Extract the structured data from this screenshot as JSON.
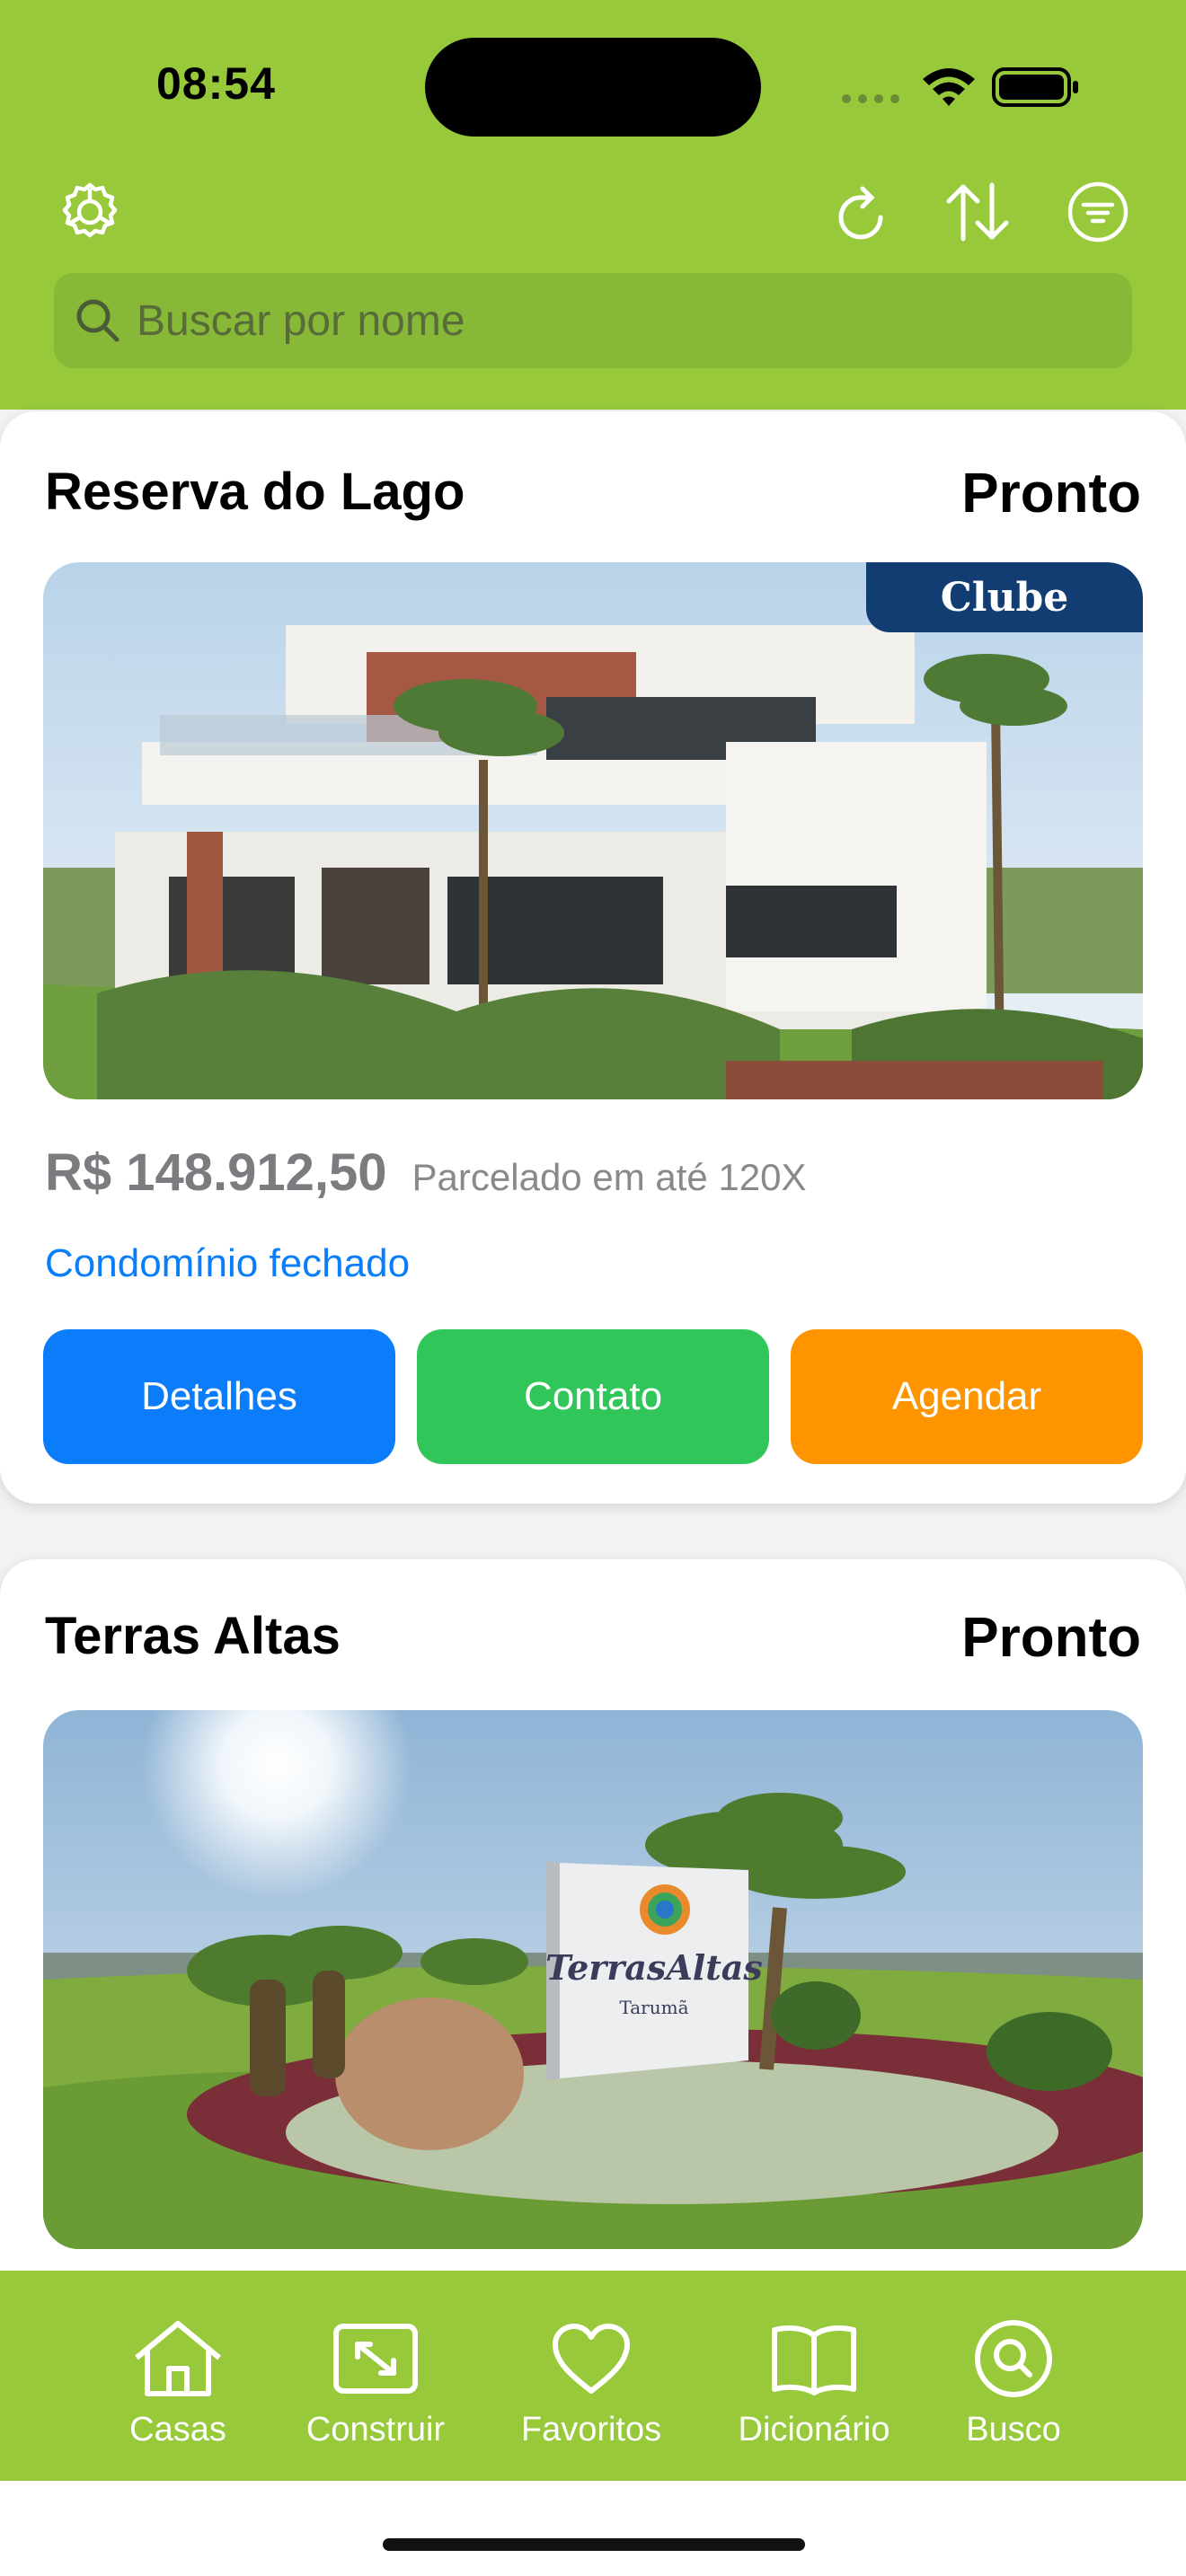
{
  "status_bar": {
    "time": "08:54"
  },
  "header": {
    "icons": [
      "settings-icon",
      "refresh-icon",
      "sort-icon",
      "filter-icon"
    ],
    "search": {
      "placeholder": "Buscar por nome",
      "value": ""
    }
  },
  "listings": [
    {
      "name": "Reserva do Lago",
      "status": "Pronto",
      "badge": "Clube",
      "price": "R$ 148.912,50",
      "installments": "Parcelado em até 120X",
      "tag": "Condomínio fechado",
      "buttons": {
        "details": "Detalhes",
        "contact": "Contato",
        "schedule": "Agendar"
      }
    },
    {
      "name": "Terras Altas",
      "status": "Pronto",
      "sign_text": "TerrasAltas",
      "sign_subtext": "Tarumã"
    }
  ],
  "tabbar": {
    "items": [
      {
        "label": "Casas",
        "icon": "house-icon"
      },
      {
        "label": "Construir",
        "icon": "expand-icon"
      },
      {
        "label": "Favoritos",
        "icon": "heart-icon"
      },
      {
        "label": "Dicionário",
        "icon": "book-icon"
      },
      {
        "label": "Busco",
        "icon": "search-circle-icon"
      }
    ]
  },
  "colors": {
    "brand_green": "#97c93a",
    "button_blue": "#0b7dfb",
    "button_green": "#31c659",
    "button_orange": "#fe9500",
    "badge_navy": "#123d72",
    "link_blue": "#0a7dfb"
  }
}
